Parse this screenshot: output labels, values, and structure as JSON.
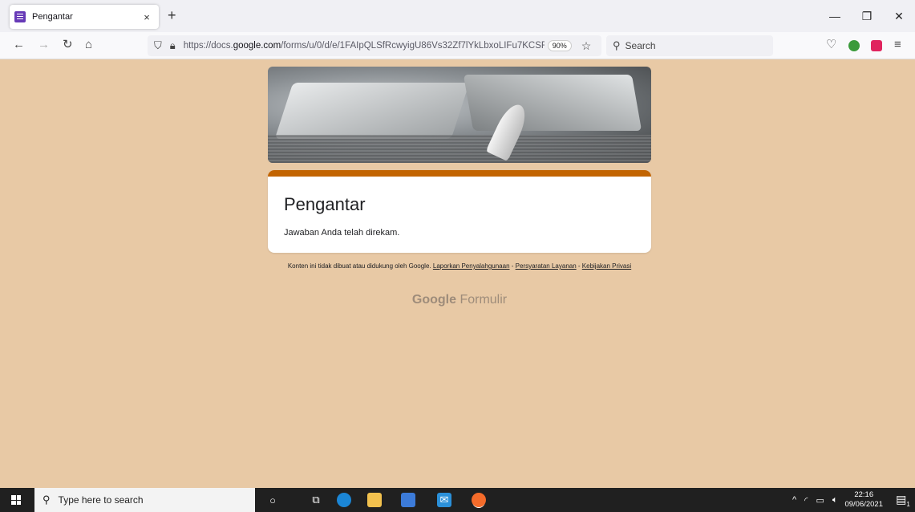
{
  "browser": {
    "tab_title": "Pengantar",
    "tab_close": "×",
    "new_tab": "+",
    "url_prefix": "https://docs.",
    "url_domain": "google.com",
    "url_rest": "/forms/u/0/d/e/1FAIpQLSfRcwyigU86Vs32Zf7lYkLbxoLIFu7KCSF",
    "zoom": "90%",
    "search_placeholder": "Search",
    "window_controls": {
      "minimize": "—",
      "restore": "❐",
      "close": "✕"
    }
  },
  "form": {
    "title": "Pengantar",
    "message": "Jawaban Anda telah direkam.",
    "accent_color": "#c26401",
    "background_color": "#e8c9a5"
  },
  "footer": {
    "disclaimer": "Konten ini tidak dibuat atau didukung oleh Google.",
    "link_abuse": "Laporkan Penyalahgunaan",
    "sep1": " - ",
    "link_terms": "Persyaratan Layanan",
    "sep2": " - ",
    "link_privacy": "Kebijakan Privasi",
    "brand_google": "Google",
    "brand_product": "Formulir"
  },
  "taskbar": {
    "search_placeholder": "Type here to search",
    "time": "22:16",
    "date": "09/06/2021",
    "notification_count": "1"
  }
}
